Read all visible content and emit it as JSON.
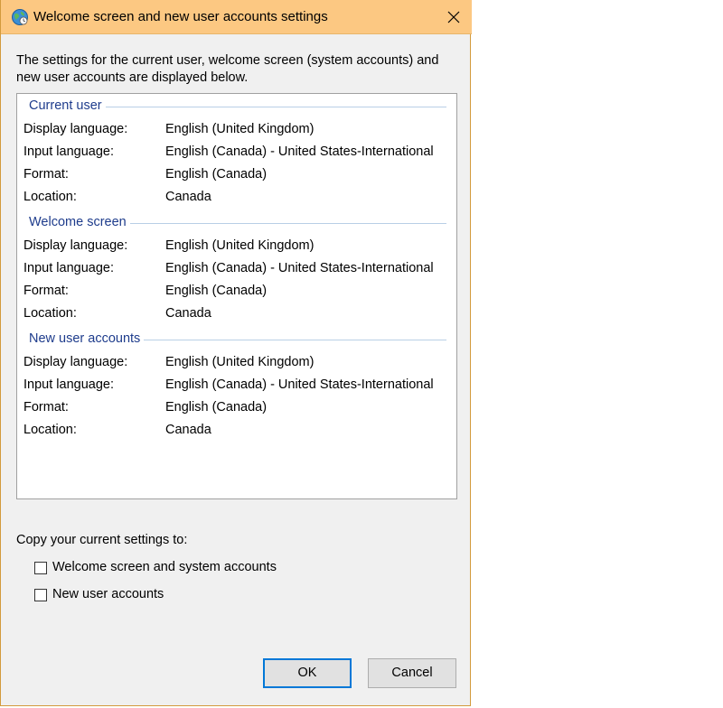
{
  "window": {
    "title": "Welcome screen and new user accounts settings",
    "icon": "globe-clock-icon",
    "close_icon": "close-icon",
    "titlebar_color": "#fcc882"
  },
  "intro": "The settings for the current user, welcome screen (system accounts) and new user accounts are displayed below.",
  "sections": [
    {
      "title": "Current user",
      "rows": [
        {
          "key": "Display language:",
          "value": "English (United Kingdom)"
        },
        {
          "key": "Input language:",
          "value": "English (Canada) - United States-International"
        },
        {
          "key": "Format:",
          "value": "English (Canada)"
        },
        {
          "key": "Location:",
          "value": "Canada"
        }
      ]
    },
    {
      "title": "Welcome screen",
      "rows": [
        {
          "key": "Display language:",
          "value": "English (United Kingdom)"
        },
        {
          "key": "Input language:",
          "value": "English (Canada) - United States-International"
        },
        {
          "key": "Format:",
          "value": "English (Canada)"
        },
        {
          "key": "Location:",
          "value": "Canada"
        }
      ]
    },
    {
      "title": "New user accounts",
      "rows": [
        {
          "key": "Display language:",
          "value": "English (United Kingdom)"
        },
        {
          "key": "Input language:",
          "value": "English (Canada) - United States-International"
        },
        {
          "key": "Format:",
          "value": "English (Canada)"
        },
        {
          "key": "Location:",
          "value": "Canada"
        }
      ]
    }
  ],
  "copy": {
    "label": "Copy your current settings to:",
    "options": [
      {
        "label": "Welcome screen and system accounts",
        "checked": false
      },
      {
        "label": "New user accounts",
        "checked": false
      }
    ]
  },
  "buttons": {
    "ok": "OK",
    "cancel": "Cancel",
    "accent": "#0078d7"
  }
}
